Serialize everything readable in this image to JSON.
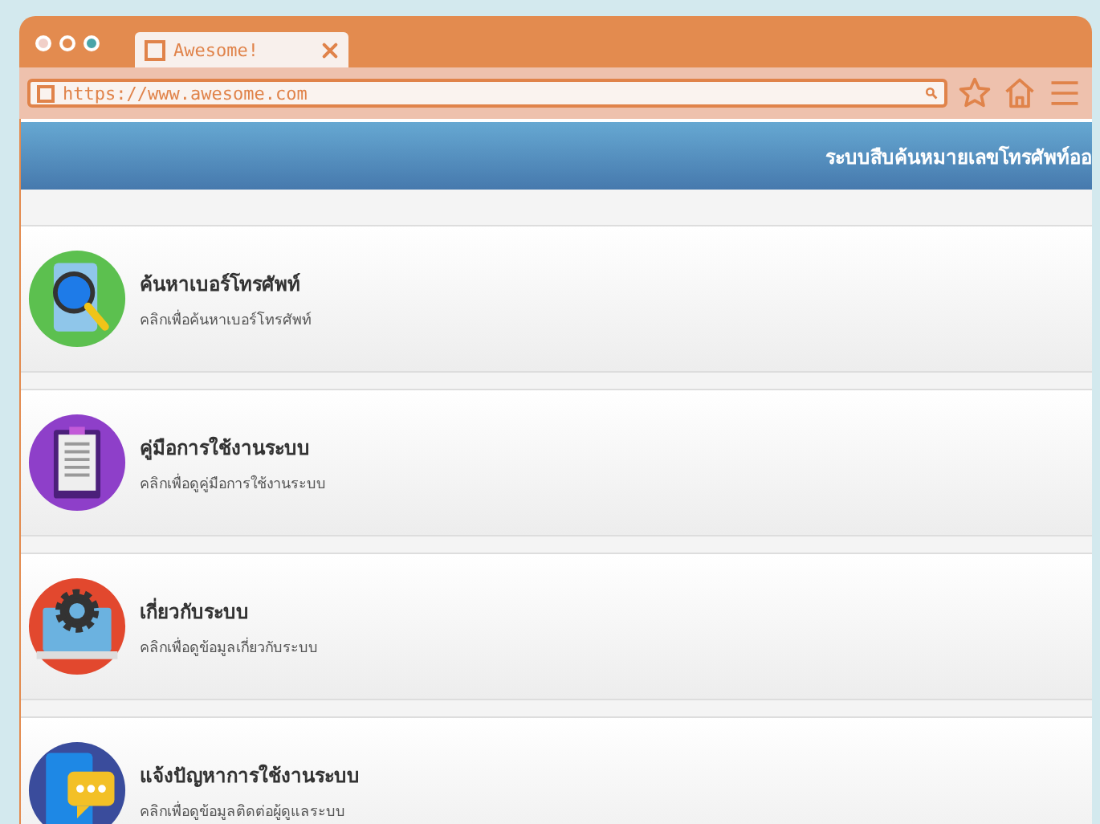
{
  "browser": {
    "tab_title": "Awesome!",
    "url": "https://www.awesome.com"
  },
  "header": {
    "title": "ระบบสืบค้นหมายเลขโทรศัพท์ออ"
  },
  "menu": [
    {
      "kind": "search",
      "color": "#5cc04f",
      "title": "ค้นหาเบอร์โทรศัพท์",
      "subtitle": "คลิกเพื่อค้นหาเบอร์โทรศัพท์"
    },
    {
      "kind": "manual",
      "color": "#8e3fc9",
      "title": "คู่มือการใช้งานระบบ",
      "subtitle": "คลิกเพื่อดูคู่มือการใช้งานระบบ"
    },
    {
      "kind": "about",
      "color": "#e2482e",
      "title": "เกี่ยวกับระบบ",
      "subtitle": "คลิกเพื่อดูข้อมูลเกี่ยวกับระบบ"
    },
    {
      "kind": "report",
      "color": "#3a4c9c",
      "title": "แจ้งปัญหาการใช้งานระบบ",
      "subtitle": "คลิกเพื่อดูข้อมูลติดต่อผู้ดูแลระบบ"
    }
  ]
}
